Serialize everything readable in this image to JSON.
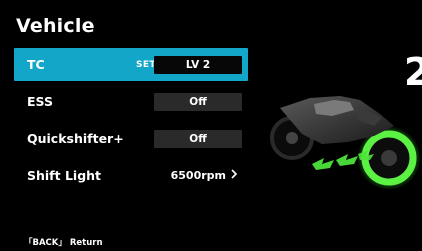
{
  "header": {
    "title": "Vehicle"
  },
  "menu": {
    "tc": {
      "label": "TC",
      "set_tag": "SET",
      "value": "LV 2"
    },
    "ess": {
      "label": "ESS",
      "value": "Off"
    },
    "quickshifter": {
      "label": "Quickshifter+",
      "value": "Off"
    },
    "shift_light": {
      "label": "Shift Light",
      "value": "6500rpm"
    }
  },
  "side": {
    "number": "2"
  },
  "footer": {
    "hint": "「BACK」 Return"
  },
  "colors": {
    "accent": "#12a7c9",
    "wheel_glow": "#3cff3c"
  },
  "icons": {
    "chevron": "chevron-right-icon"
  }
}
